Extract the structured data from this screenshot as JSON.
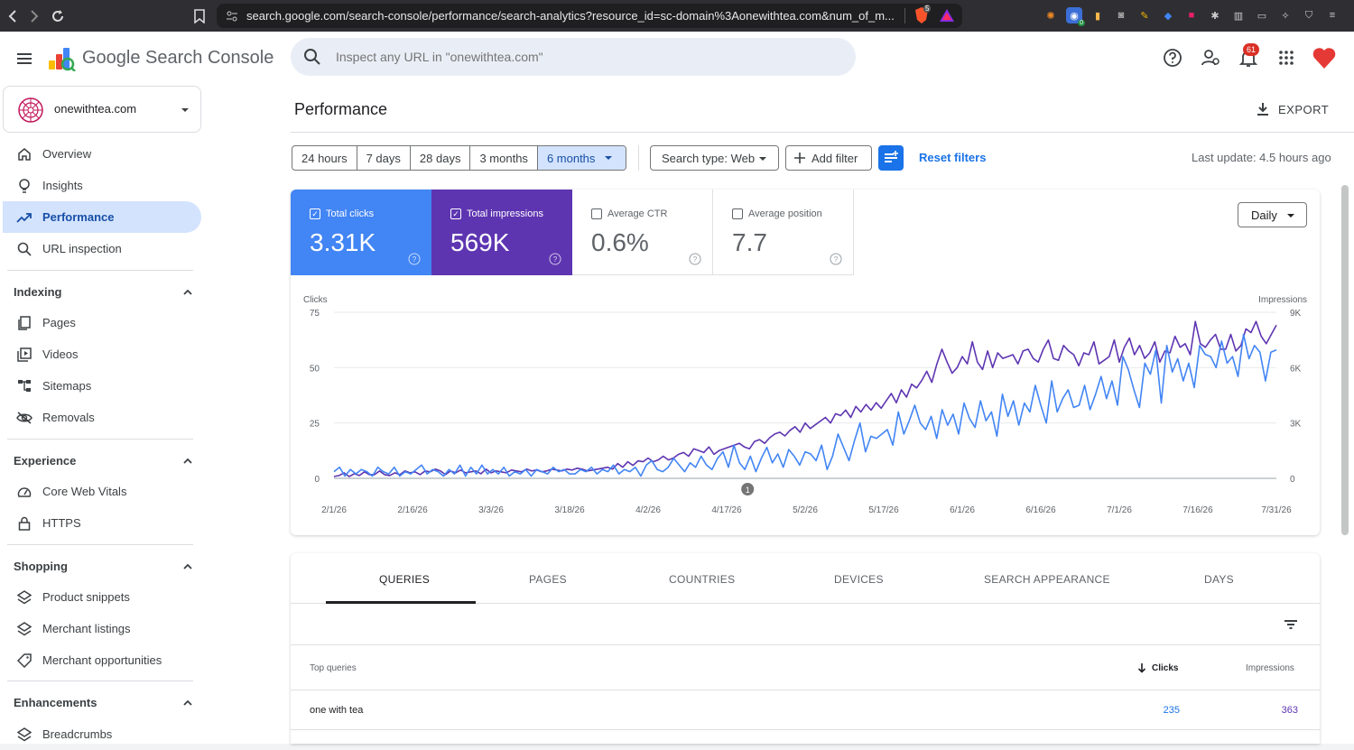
{
  "browser": {
    "url": "search.google.com/search-console/performance/search-analytics?resource_id=sc-domain%3Aonewithtea.com&num_of_m...",
    "notification_counts": {
      "brave": "5",
      "extension": "0"
    }
  },
  "header": {
    "product": "Google Search Console",
    "search_placeholder": "Inspect any URL in \"onewithtea.com\"",
    "notification_count": "61"
  },
  "property": {
    "name": "onewithtea.com"
  },
  "sidebar": {
    "top_items": [
      {
        "label": "Overview",
        "icon": "home-icon"
      },
      {
        "label": "Insights",
        "icon": "lightbulb-icon"
      },
      {
        "label": "Performance",
        "icon": "trending-up-icon",
        "active": true
      },
      {
        "label": "URL inspection",
        "icon": "search-icon"
      }
    ],
    "sections": [
      {
        "title": "Indexing",
        "items": [
          "Pages",
          "Videos",
          "Sitemaps",
          "Removals"
        ]
      },
      {
        "title": "Experience",
        "items": [
          "Core Web Vitals",
          "HTTPS"
        ]
      },
      {
        "title": "Shopping",
        "items": [
          "Product snippets",
          "Merchant listings",
          "Merchant opportunities"
        ]
      },
      {
        "title": "Enhancements",
        "items": [
          "Breadcrumbs"
        ]
      }
    ]
  },
  "page": {
    "title": "Performance",
    "export_label": "EXPORT",
    "ranges": [
      "24 hours",
      "7 days",
      "28 days",
      "3 months",
      "6 months"
    ],
    "selected_range": "6 months",
    "search_type": "Search type: Web",
    "add_filter": "Add filter",
    "reset_filters": "Reset filters",
    "last_update": "Last update: 4.5 hours ago"
  },
  "metrics": [
    {
      "label": "Total clicks",
      "value": "3.31K",
      "checked": true,
      "color": "#4285f4"
    },
    {
      "label": "Total impressions",
      "value": "569K",
      "checked": true,
      "color": "#5e35b1"
    },
    {
      "label": "Average CTR",
      "value": "0.6%",
      "checked": false
    },
    {
      "label": "Average position",
      "value": "7.7",
      "checked": false
    }
  ],
  "granularity": "Daily",
  "chart_data": {
    "type": "line",
    "ylabel_left": "Clicks",
    "ylabel_right": "Impressions",
    "y_left_ticks": [
      "0",
      "25",
      "50",
      "75"
    ],
    "y_right_ticks": [
      "0",
      "3K",
      "6K",
      "9K"
    ],
    "ylim_left": [
      0,
      75
    ],
    "ylim_right": [
      0,
      9000
    ],
    "x_ticks": [
      "2/1/26",
      "2/16/26",
      "3/3/26",
      "3/18/26",
      "4/2/26",
      "4/17/26",
      "5/2/26",
      "5/17/26",
      "6/1/26",
      "6/16/26",
      "7/1/26",
      "7/16/26",
      "7/31/26"
    ],
    "annotation": {
      "label": "1",
      "x": "4/21/26"
    },
    "grid": true,
    "series": [
      {
        "name": "Clicks",
        "color": "#4285f4",
        "values": [
          3,
          5,
          1,
          4,
          2,
          4,
          3,
          1,
          5,
          3,
          2,
          5,
          1,
          3,
          2,
          4,
          6,
          2,
          4,
          3,
          1,
          4,
          2,
          6,
          1,
          5,
          2,
          6,
          2,
          4,
          2,
          5,
          1,
          3,
          2,
          4,
          1,
          4,
          3,
          2,
          5,
          3,
          4,
          2,
          2,
          4,
          3,
          5,
          2,
          4,
          3,
          6,
          2,
          4,
          3,
          5,
          1,
          6,
          8,
          4,
          3,
          5,
          9,
          6,
          3,
          7,
          5,
          10,
          6,
          4,
          9,
          12,
          5,
          15,
          7,
          4,
          10,
          3,
          9,
          14,
          7,
          11,
          5,
          13,
          10,
          6,
          12,
          11,
          8,
          15,
          4,
          10,
          20,
          14,
          8,
          17,
          25,
          12,
          19,
          18,
          20,
          22,
          15,
          30,
          20,
          26,
          33,
          25,
          22,
          28,
          18,
          31,
          24,
          29,
          20,
          34,
          27,
          23,
          35,
          26,
          30,
          19,
          38,
          28,
          35,
          24,
          34,
          30,
          42,
          33,
          25,
          44,
          30,
          36,
          40,
          32,
          33,
          42,
          31,
          38,
          46,
          36,
          44,
          33,
          55,
          49,
          40,
          32,
          52,
          47,
          58,
          34,
          60,
          48,
          54,
          44,
          52,
          41,
          60,
          56,
          55,
          50,
          62,
          52,
          55,
          46,
          65,
          54,
          60,
          57,
          44,
          57,
          58
        ]
      },
      {
        "name": "Impressions",
        "color": "#5e35b1",
        "values": [
          100,
          150,
          300,
          100,
          250,
          150,
          350,
          200,
          200,
          400,
          200,
          150,
          300,
          200,
          400,
          300,
          350,
          200,
          400,
          350,
          500,
          400,
          200,
          400,
          300,
          450,
          300,
          350,
          400,
          250,
          500,
          300,
          400,
          350,
          300,
          450,
          400,
          350,
          500,
          400,
          450,
          350,
          400,
          500,
          450,
          400,
          500,
          450,
          550,
          500,
          400,
          450,
          500,
          550,
          600,
          500,
          800,
          600,
          900,
          700,
          950,
          900,
          1100,
          900,
          1000,
          1200,
          1000,
          1100,
          1300,
          1400,
          1200,
          1600,
          1500,
          1400,
          1700,
          1300,
          1500,
          1600,
          1700,
          1800,
          1900,
          1700,
          1600,
          2000,
          2100,
          1900,
          2200,
          2400,
          2500,
          2300,
          2600,
          2800,
          2500,
          3000,
          2700,
          2900,
          3100,
          3300,
          3000,
          3500,
          3400,
          3700,
          3300,
          3900,
          3600,
          4000,
          3700,
          4100,
          3800,
          4200,
          4600,
          4100,
          4800,
          4400,
          5100,
          4900,
          5300,
          5800,
          5200,
          6200,
          7000,
          6300,
          5700,
          6000,
          6600,
          6200,
          7400,
          6300,
          5900,
          6900,
          6000,
          6800,
          6500,
          6600,
          6700,
          6200,
          6900,
          7000,
          6500,
          6300,
          7000,
          7500,
          6500,
          6400,
          7200,
          6900,
          6700,
          6100,
          6800,
          6700,
          7400,
          6200,
          6400,
          6600,
          7500,
          6300,
          7100,
          7600,
          6700,
          7200,
          6500,
          6800,
          7400,
          6300,
          6900,
          6800,
          7700,
          7100,
          7300,
          6700,
          8500,
          7300,
          7100,
          7500,
          7800,
          7000,
          7000,
          7800,
          6900,
          7200,
          8100,
          7900,
          8500,
          7700,
          7300,
          7800,
          8300
        ]
      }
    ]
  },
  "table": {
    "tabs": [
      "QUERIES",
      "PAGES",
      "COUNTRIES",
      "DEVICES",
      "SEARCH APPEARANCE",
      "DAYS"
    ],
    "selected_tab": "QUERIES",
    "headers": {
      "query": "Top queries",
      "clicks": "Clicks",
      "impressions": "Impressions"
    },
    "rows": [
      {
        "query": "one with tea",
        "clicks": "235",
        "impressions": "363"
      }
    ]
  }
}
